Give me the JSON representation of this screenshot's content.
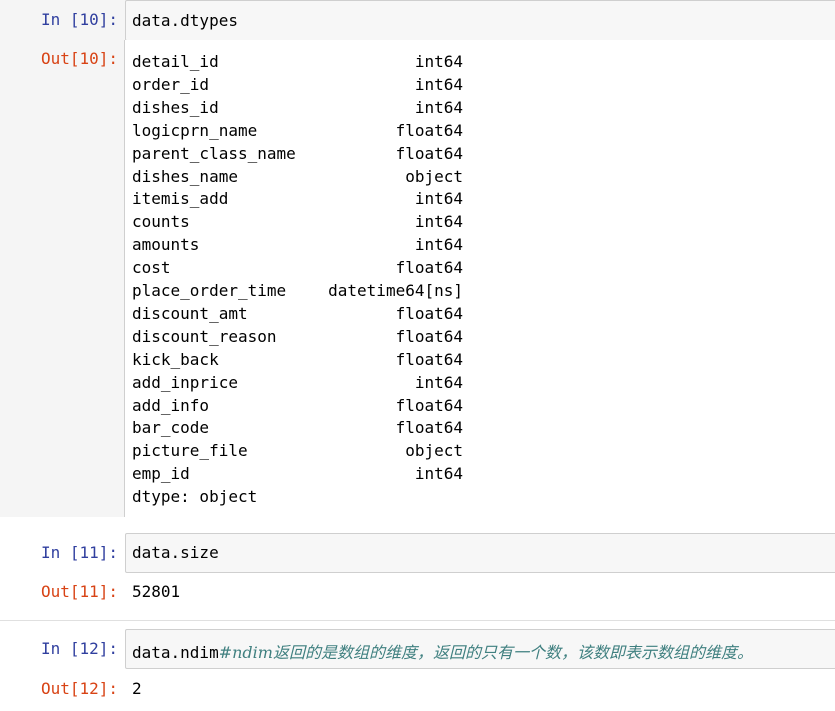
{
  "cells": [
    {
      "in_prompt": "In  [10]:",
      "code": "data.dtypes",
      "out_prompt": "Out[10]:",
      "output_rows": [
        {
          "name": "detail_id",
          "dtype": "int64"
        },
        {
          "name": "order_id",
          "dtype": "int64"
        },
        {
          "name": "dishes_id",
          "dtype": "int64"
        },
        {
          "name": "logicprn_name",
          "dtype": "float64"
        },
        {
          "name": "parent_class_name",
          "dtype": "float64"
        },
        {
          "name": "dishes_name",
          "dtype": "object"
        },
        {
          "name": "itemis_add",
          "dtype": "int64"
        },
        {
          "name": "counts",
          "dtype": "int64"
        },
        {
          "name": "amounts",
          "dtype": "int64"
        },
        {
          "name": "cost",
          "dtype": "float64"
        },
        {
          "name": "place_order_time",
          "dtype": "datetime64[ns]"
        },
        {
          "name": "discount_amt",
          "dtype": "float64"
        },
        {
          "name": "discount_reason",
          "dtype": "float64"
        },
        {
          "name": "kick_back",
          "dtype": "float64"
        },
        {
          "name": "add_inprice",
          "dtype": "int64"
        },
        {
          "name": "add_info",
          "dtype": "float64"
        },
        {
          "name": "bar_code",
          "dtype": "float64"
        },
        {
          "name": "picture_file",
          "dtype": "object"
        },
        {
          "name": "emp_id",
          "dtype": "int64"
        }
      ],
      "output_footer": "dtype: object"
    },
    {
      "in_prompt": "In  [11]:",
      "code": "data.size",
      "out_prompt": "Out[11]:",
      "output": "52801"
    },
    {
      "in_prompt": "In  [12]:",
      "code": "data.ndim",
      "comment": "#ndim返回的是数组的维度，返回的只有一个数，该数即表示数组的维度。",
      "out_prompt": "Out[12]:",
      "output": "2"
    }
  ],
  "colors": {
    "in_prompt": "#303f9f",
    "out_prompt": "#d84315",
    "comment": "#408080",
    "input_bg": "#f7f7f7"
  }
}
